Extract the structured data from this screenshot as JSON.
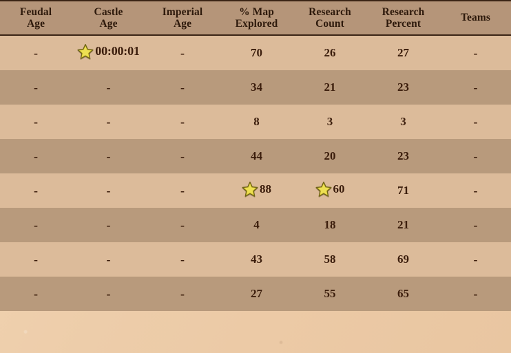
{
  "theme": {
    "background": "#edcdaa",
    "header_bg": "#b59579",
    "row_light": "#dcbb9a",
    "row_dark": "#b89a7c",
    "text": "#3b1d0c",
    "border": "#3a2415",
    "star_fill": "#e2d13a",
    "star_stroke": "#6f6416"
  },
  "table": {
    "columns": [
      {
        "line1": "Feudal",
        "line2": "Age",
        "name": "feudal-age"
      },
      {
        "line1": "Castle",
        "line2": "Age",
        "name": "castle-age"
      },
      {
        "line1": "Imperial",
        "line2": "Age",
        "name": "imperial-age"
      },
      {
        "line1": "% Map",
        "line2": "Explored",
        "name": "map-explored"
      },
      {
        "line1": "Research",
        "line2": "Count",
        "name": "research-count"
      },
      {
        "line1": "Research",
        "line2": "Percent",
        "name": "research-percent"
      },
      {
        "line1": "Teams",
        "line2": "",
        "name": "teams"
      }
    ],
    "rows": [
      {
        "shade": "light",
        "cells": [
          {
            "text": "-"
          },
          {
            "text": "00:00:01",
            "star": true
          },
          {
            "text": "-"
          },
          {
            "text": "70"
          },
          {
            "text": "26"
          },
          {
            "text": "27"
          },
          {
            "text": "-"
          }
        ]
      },
      {
        "shade": "dark",
        "cells": [
          {
            "text": "-"
          },
          {
            "text": "-"
          },
          {
            "text": "-"
          },
          {
            "text": "34"
          },
          {
            "text": "21"
          },
          {
            "text": "23"
          },
          {
            "text": "-"
          }
        ]
      },
      {
        "shade": "light",
        "cells": [
          {
            "text": "-"
          },
          {
            "text": "-"
          },
          {
            "text": "-"
          },
          {
            "text": "8"
          },
          {
            "text": "3"
          },
          {
            "text": "3"
          },
          {
            "text": "-"
          }
        ]
      },
      {
        "shade": "dark",
        "cells": [
          {
            "text": "-"
          },
          {
            "text": "-"
          },
          {
            "text": "-"
          },
          {
            "text": "44"
          },
          {
            "text": "20"
          },
          {
            "text": "23"
          },
          {
            "text": "-"
          }
        ]
      },
      {
        "shade": "light",
        "cells": [
          {
            "text": "-"
          },
          {
            "text": "-"
          },
          {
            "text": "-"
          },
          {
            "text": "88",
            "star": true
          },
          {
            "text": "60",
            "star": true
          },
          {
            "text": "71"
          },
          {
            "text": "-"
          }
        ]
      },
      {
        "shade": "dark",
        "cells": [
          {
            "text": "-"
          },
          {
            "text": "-"
          },
          {
            "text": "-"
          },
          {
            "text": "4"
          },
          {
            "text": "18"
          },
          {
            "text": "21"
          },
          {
            "text": "-"
          }
        ]
      },
      {
        "shade": "light",
        "cells": [
          {
            "text": "-"
          },
          {
            "text": "-"
          },
          {
            "text": "-"
          },
          {
            "text": "43"
          },
          {
            "text": "58"
          },
          {
            "text": "69"
          },
          {
            "text": "-"
          }
        ]
      },
      {
        "shade": "dark",
        "cells": [
          {
            "text": "-"
          },
          {
            "text": "-"
          },
          {
            "text": "-"
          },
          {
            "text": "27"
          },
          {
            "text": "55"
          },
          {
            "text": "65"
          },
          {
            "text": "-"
          }
        ]
      }
    ]
  },
  "icons": {
    "star": "star-icon"
  }
}
